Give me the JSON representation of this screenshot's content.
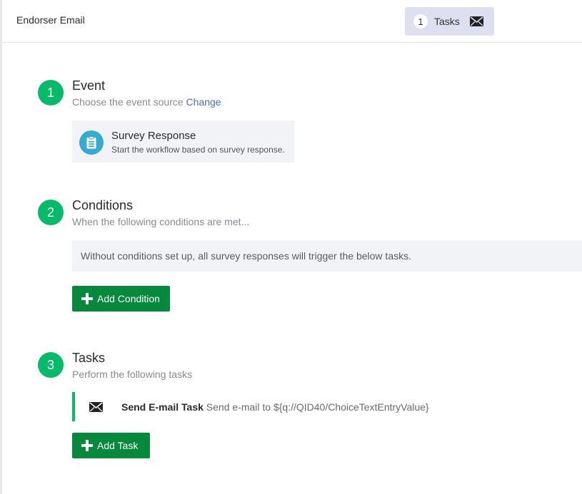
{
  "header": {
    "title": "Endorser Email",
    "tasks_count": "1",
    "tasks_label": "Tasks"
  },
  "event": {
    "number": "1",
    "title": "Event",
    "subtitle": "Choose the event source",
    "change_link": "Change",
    "source_title": "Survey Response",
    "source_description": "Start the workflow based on survey response."
  },
  "conditions": {
    "number": "2",
    "title": "Conditions",
    "subtitle": "When the following conditions are met...",
    "note": "Without conditions set up, all survey responses will trigger the below tasks.",
    "add_button": "Add Condition"
  },
  "tasks": {
    "number": "3",
    "title": "Tasks",
    "subtitle": "Perform the following tasks",
    "items": [
      {
        "name": "Send E-mail Task",
        "description": "Send e-mail to ${q://QID40/ChoiceTextEntryValue}",
        "icon": "envelope-icon"
      }
    ],
    "add_button": "Add Task"
  },
  "colors": {
    "step_circle": "#07ba6a",
    "button": "#07893d",
    "link": "#4c71a6",
    "survey_icon_bg": "#38a9cf",
    "tasks_pill_bg": "#dedff0"
  }
}
